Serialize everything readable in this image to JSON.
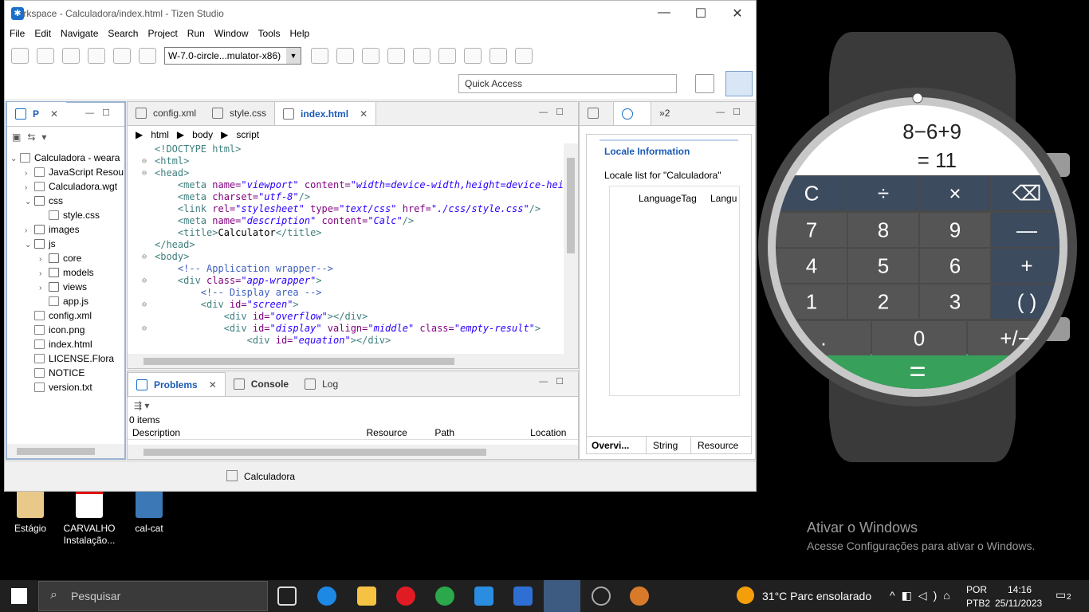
{
  "window": {
    "title": "workspace - Calculadora/index.html - Tizen Studio",
    "menu": [
      "File",
      "Edit",
      "Navigate",
      "Search",
      "Project",
      "Run",
      "Window",
      "Tools",
      "Help"
    ],
    "target_combo": "W-7.0-circle...mulator-x86)",
    "quick_access_placeholder": "Quick Access"
  },
  "project_explorer": {
    "tab_label": "P",
    "tree": [
      {
        "label": "Calculadora - weara",
        "depth": 0,
        "twisty": "v",
        "kind": "project"
      },
      {
        "label": "JavaScript Resou",
        "depth": 1,
        "twisty": ">",
        "kind": "lib"
      },
      {
        "label": "Calculadora.wgt",
        "depth": 1,
        "twisty": ">",
        "kind": "file"
      },
      {
        "label": "css",
        "depth": 1,
        "twisty": "v",
        "kind": "folder"
      },
      {
        "label": "style.css",
        "depth": 2,
        "twisty": "",
        "kind": "file"
      },
      {
        "label": "images",
        "depth": 1,
        "twisty": ">",
        "kind": "folder"
      },
      {
        "label": "js",
        "depth": 1,
        "twisty": "v",
        "kind": "folder"
      },
      {
        "label": "core",
        "depth": 2,
        "twisty": ">",
        "kind": "folder"
      },
      {
        "label": "models",
        "depth": 2,
        "twisty": ">",
        "kind": "folder"
      },
      {
        "label": "views",
        "depth": 2,
        "twisty": ">",
        "kind": "folder"
      },
      {
        "label": "app.js",
        "depth": 2,
        "twisty": "",
        "kind": "file"
      },
      {
        "label": "config.xml",
        "depth": 1,
        "twisty": "",
        "kind": "file"
      },
      {
        "label": "icon.png",
        "depth": 1,
        "twisty": "",
        "kind": "file"
      },
      {
        "label": "index.html",
        "depth": 1,
        "twisty": "",
        "kind": "file"
      },
      {
        "label": "LICENSE.Flora",
        "depth": 1,
        "twisty": "",
        "kind": "file"
      },
      {
        "label": "NOTICE",
        "depth": 1,
        "twisty": "",
        "kind": "file"
      },
      {
        "label": "version.txt",
        "depth": 1,
        "twisty": "",
        "kind": "file"
      }
    ]
  },
  "editor": {
    "tabs": [
      "config.xml",
      "style.css",
      "index.html"
    ],
    "active_tab": "index.html",
    "breadcrumb": [
      "html",
      "body",
      "script"
    ]
  },
  "problems": {
    "tabs": [
      "Problems",
      "Console",
      "Log"
    ],
    "count": "0 items",
    "columns": [
      "Description",
      "Resource",
      "Path",
      "Location"
    ]
  },
  "locale_panel": {
    "tab_suffix": "2",
    "title": "Locale Information",
    "subtitle": "Locale list for \"Calculadora\"",
    "columns": [
      "LanguageTag",
      "Langu"
    ],
    "bottom_tabs": [
      "Overvi...",
      "String",
      "Resource"
    ]
  },
  "status_bar": {
    "selection": "Calculadora"
  },
  "desktop_icons": [
    {
      "label": "Estágio",
      "color": "#e9c98a"
    },
    {
      "label": "CARVALHO Instalação...",
      "color": "#ffffff"
    },
    {
      "label": "cal-cat",
      "color": "#3b78b5"
    }
  ],
  "watermark": {
    "line1": "Ativar o Windows",
    "line2": "Acesse Configurações para ativar o Windows."
  },
  "calculator": {
    "equation": "8−6+9",
    "result": "= 11",
    "rows": [
      [
        "C",
        "÷",
        "×",
        "⌫"
      ],
      [
        "7",
        "8",
        "9",
        "—"
      ],
      [
        "4",
        "5",
        "6",
        "+"
      ],
      [
        "1",
        "2",
        "3",
        "( )"
      ],
      [
        ".",
        "0",
        "+/−"
      ]
    ],
    "equals": "="
  },
  "taskbar": {
    "search_placeholder": "Pesquisar",
    "weather": "31°C  Parc ensolarado",
    "lang1": "POR",
    "lang2": "PTB2",
    "time": "14:16",
    "date": "25/11/2023",
    "notif_count": "2"
  }
}
